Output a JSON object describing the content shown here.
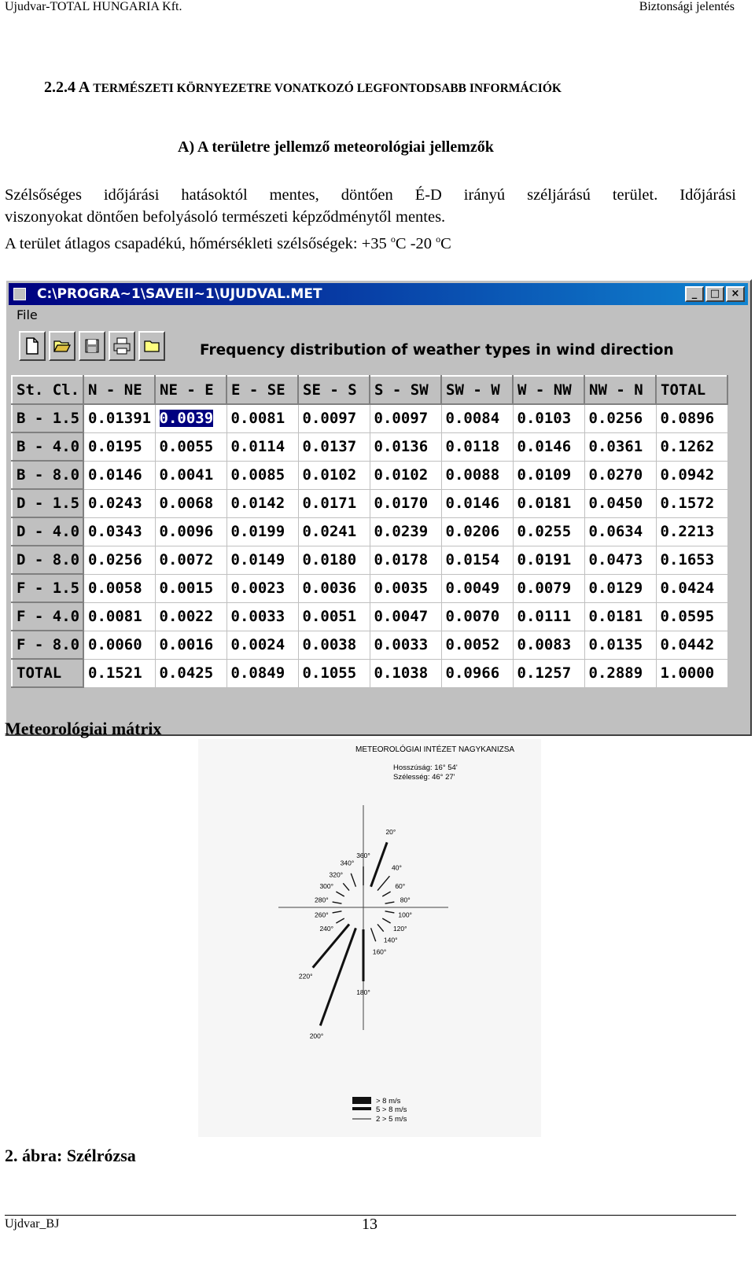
{
  "header": {
    "left": "Ujudvar-TOTAL HUNGARIA Kft.",
    "right": "Biztonsági jelentés"
  },
  "section": {
    "number": "2.2.4",
    "first_letter": "A",
    "title_rest": "TERMÉSZETI KÖRNYEZETRE VONATKOZÓ LEGFONTODSABB INFORMÁCIÓK"
  },
  "subtitle": "A) A területre jellemző meteorológiai jellemzők",
  "paragraph": {
    "line1": "Szélsőséges időjárási hatásoktól mentes, döntően É-D irányú széljárású terület. Időjárási",
    "line2": "viszonyokat döntően befolyásoló természeti képződménytől mentes.",
    "line3_prefix": "A terület átlagos csapadékú, hőmérsékleti szélsőségek: +35",
    "deg1": "o",
    "unit1": "C -20",
    "deg2": "o",
    "unit2": "C"
  },
  "app": {
    "title": "C:\\PROGRA~1\\SAVEII~1\\UJUDVAL.MET",
    "menu": [
      "File"
    ],
    "window_buttons": [
      "_",
      "□",
      "×"
    ],
    "toolbar_icons": [
      "new-icon",
      "open-icon",
      "save-icon",
      "print-icon",
      "folder-icon"
    ],
    "table_title": "Frequency distribution of weather types in wind direction",
    "columns": [
      "St. Cl.",
      "N - NE",
      "NE - E",
      "E - SE",
      "SE - S",
      "S - SW",
      "SW - W",
      "W - NW",
      "NW - N",
      "TOTAL"
    ],
    "rows": [
      {
        "label": "B - 1.5",
        "values": [
          "0.01391",
          "0.0039",
          "0.0081",
          "0.0097",
          "0.0097",
          "0.0084",
          "0.0103",
          "0.0256",
          "0.0896"
        ]
      },
      {
        "label": "B - 4.0",
        "values": [
          "0.0195",
          "0.0055",
          "0.0114",
          "0.0137",
          "0.0136",
          "0.0118",
          "0.0146",
          "0.0361",
          "0.1262"
        ]
      },
      {
        "label": "B - 8.0",
        "values": [
          "0.0146",
          "0.0041",
          "0.0085",
          "0.0102",
          "0.0102",
          "0.0088",
          "0.0109",
          "0.0270",
          "0.0942"
        ]
      },
      {
        "label": "D - 1.5",
        "values": [
          "0.0243",
          "0.0068",
          "0.0142",
          "0.0171",
          "0.0170",
          "0.0146",
          "0.0181",
          "0.0450",
          "0.1572"
        ]
      },
      {
        "label": "D - 4.0",
        "values": [
          "0.0343",
          "0.0096",
          "0.0199",
          "0.0241",
          "0.0239",
          "0.0206",
          "0.0255",
          "0.0634",
          "0.2213"
        ]
      },
      {
        "label": "D - 8.0",
        "values": [
          "0.0256",
          "0.0072",
          "0.0149",
          "0.0180",
          "0.0178",
          "0.0154",
          "0.0191",
          "0.0473",
          "0.1653"
        ]
      },
      {
        "label": "F - 1.5",
        "values": [
          "0.0058",
          "0.0015",
          "0.0023",
          "0.0036",
          "0.0035",
          "0.0049",
          "0.0079",
          "0.0129",
          "0.0424"
        ]
      },
      {
        "label": "F - 4.0",
        "values": [
          "0.0081",
          "0.0022",
          "0.0033",
          "0.0051",
          "0.0047",
          "0.0070",
          "0.0111",
          "0.0181",
          "0.0595"
        ]
      },
      {
        "label": "F - 8.0",
        "values": [
          "0.0060",
          "0.0016",
          "0.0024",
          "0.0038",
          "0.0033",
          "0.0052",
          "0.0083",
          "0.0135",
          "0.0442"
        ]
      },
      {
        "label": "TOTAL",
        "values": [
          "0.1521",
          "0.0425",
          "0.0849",
          "0.1055",
          "0.1038",
          "0.0966",
          "0.1257",
          "0.2889",
          "1.0000"
        ]
      }
    ],
    "selected_cell": {
      "row": 0,
      "col": 1
    }
  },
  "caption_matrix": "Meteorológiai mátrix",
  "windrose": {
    "institute": "METEOROLÓGIAI INTÉZET NAGYKANIZSA",
    "longitude": "Hosszúság: 16° 54'",
    "latitude": "Szélesség:  46° 27'",
    "directions": [
      {
        "label": "20°",
        "deg": 20,
        "len": 5
      },
      {
        "label": "40°",
        "deg": 40,
        "len": 2
      },
      {
        "label": "60°",
        "deg": 60,
        "len": 1
      },
      {
        "label": "80°",
        "deg": 80,
        "len": 1
      },
      {
        "label": "100°",
        "deg": 100,
        "len": 1
      },
      {
        "label": "120°",
        "deg": 120,
        "len": 1
      },
      {
        "label": "140°",
        "deg": 140,
        "len": 1
      },
      {
        "label": "160°",
        "deg": 160,
        "len": 1.5
      },
      {
        "label": "180°",
        "deg": 180,
        "len": 5.5
      },
      {
        "label": "200°",
        "deg": 200,
        "len": 11
      },
      {
        "label": "220°",
        "deg": 220,
        "len": 6
      },
      {
        "label": "240°",
        "deg": 240,
        "len": 1
      },
      {
        "label": "260°",
        "deg": 260,
        "len": 1
      },
      {
        "label": "280°",
        "deg": 280,
        "len": 1
      },
      {
        "label": "300°",
        "deg": 300,
        "len": 1
      },
      {
        "label": "320°",
        "deg": 320,
        "len": 1
      },
      {
        "label": "340°",
        "deg": 340,
        "len": 1.5
      },
      {
        "label": "360°",
        "deg": 360,
        "len": 2
      }
    ],
    "legend": [
      "> 8 m/s",
      "5 > 8 m/s",
      "2 > 5 m/s"
    ]
  },
  "caption_figure": "2. ábra: Szélrózsa",
  "footer": {
    "left": "Ujdvar_BJ",
    "page": "13"
  }
}
